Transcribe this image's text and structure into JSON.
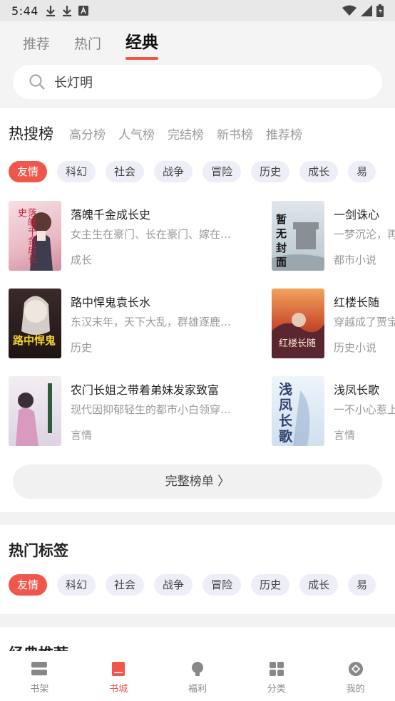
{
  "status_bar": {
    "time": "5:44"
  },
  "top_tabs": [
    "推荐",
    "热门",
    "经典"
  ],
  "search": {
    "query": "长灯明"
  },
  "ranking": {
    "tabs": [
      "热搜榜",
      "高分榜",
      "人气榜",
      "完结榜",
      "新书榜",
      "推荐榜"
    ],
    "categories": [
      "友情",
      "科幻",
      "社会",
      "战争",
      "冒险",
      "历史",
      "成长",
      "易"
    ],
    "books_left": [
      {
        "title": "落魄千金成长史",
        "desc": "女主生在豪门、长在豪门、嫁在…",
        "genre": "成长"
      },
      {
        "title": "路中悍鬼袁长水",
        "desc": "东汉末年，天下大乱，群雄逐鹿…",
        "genre": "历史"
      },
      {
        "title": "农门长姐之带着弟妹发家致富",
        "desc": "现代因抑郁轻生的都市小白领穿…",
        "genre": "言情"
      }
    ],
    "books_right": [
      {
        "title": "一剑诛心",
        "desc": "一梦沉沦，再",
        "genre": "都市小说"
      },
      {
        "title": "红楼长随",
        "desc": "穿越成了贾宝",
        "genre": "历史小说"
      },
      {
        "title": "浅凤长歌",
        "desc": "一不小心惹上",
        "genre": "言情"
      }
    ],
    "covers": {
      "c1_text": "落魄千金成长史",
      "c2_text": "暂无封面",
      "c4_text": "红楼长随",
      "c5_text": "路中悍鬼",
      "c6_text": "浅凤长歌"
    },
    "full_list_label": "完整榜单 〉"
  },
  "hot_tags": {
    "title": "热门标签",
    "tags": [
      "友情",
      "科幻",
      "社会",
      "战争",
      "冒险",
      "历史",
      "成长",
      "易"
    ]
  },
  "next_section_title": "经典推荐",
  "bottom_nav": [
    "书架",
    "书城",
    "福利",
    "分类",
    "我的"
  ],
  "colors": {
    "accent": "#f0564a",
    "chip_bg": "#eeeef8"
  }
}
